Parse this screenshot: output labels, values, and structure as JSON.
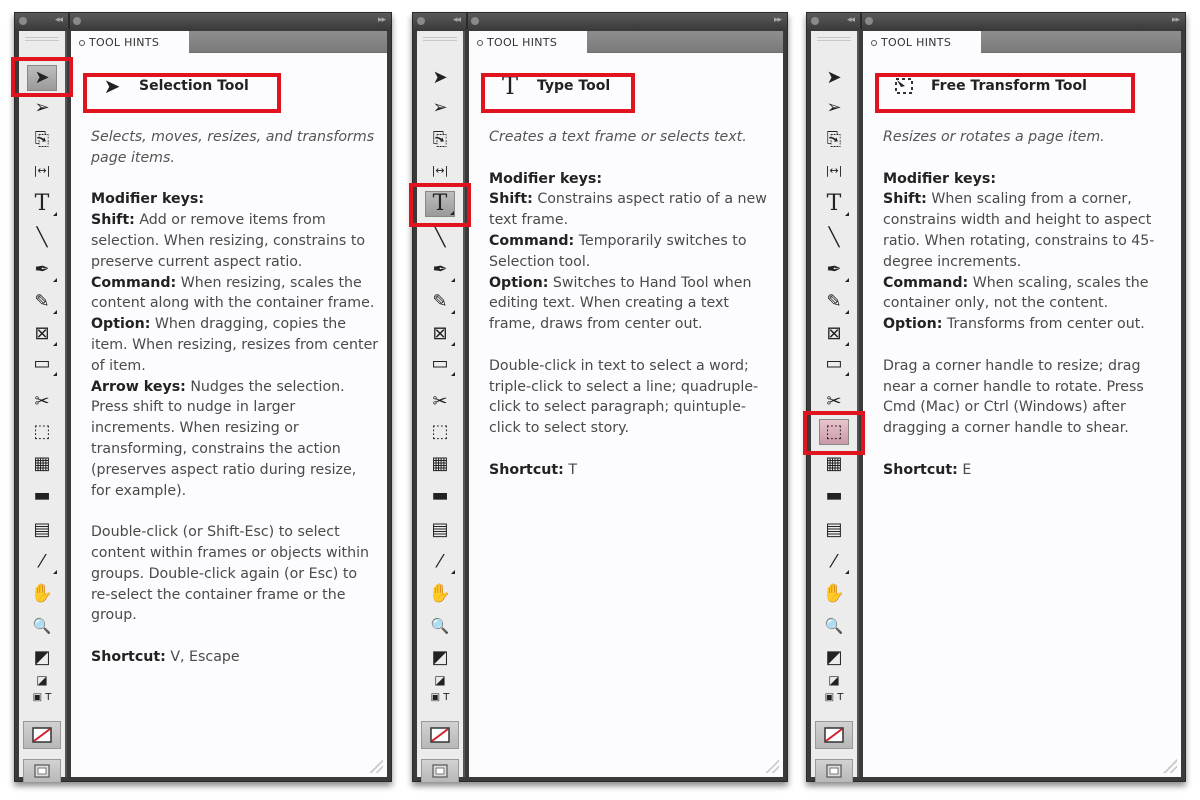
{
  "panels": [
    {
      "tab_label": "TOOL HINTS",
      "hint": {
        "icon": "selection-arrow-icon",
        "title": "Selection Tool",
        "description": "Selects, moves, resizes, and transforms page items.",
        "modifier_heading": "Modifier keys:",
        "modifiers": [
          {
            "key": "Shift:",
            "text": " Add or remove items from selection. When resizing, constrains to preserve current aspect ratio."
          },
          {
            "key": "Command:",
            "text": " When resizing, scales the content along with the container frame."
          },
          {
            "key": "Option:",
            "text": " When dragging, copies the item. When resizing, resizes from center of item."
          },
          {
            "key": "Arrow keys:",
            "text": " Nudges the selection. Press shift to nudge in larger increments. When resizing or transforming, constrains the action (preserves aspect ratio during resize, for example)."
          }
        ],
        "extra": "Double-click (or Shift-Esc) to select content within frames or objects within groups. Double-click again (or Esc) to re-select the container frame or the group.",
        "shortcut_label": "Shortcut:",
        "shortcut_value": " V, Escape"
      },
      "active_tool": "selection"
    },
    {
      "tab_label": "TOOL HINTS",
      "hint": {
        "icon": "type-tool-icon",
        "title": "Type Tool",
        "description": "Creates a text frame or selects text.",
        "modifier_heading": "Modifier keys:",
        "modifiers": [
          {
            "key": "Shift:",
            "text": " Constrains aspect ratio of a new text frame."
          },
          {
            "key": "Command:",
            "text": " Temporarily switches to Selection tool."
          },
          {
            "key": "Option:",
            "text": " Switches to Hand Tool when editing text. When creating a text frame, draws from center out."
          }
        ],
        "extra": "Double-click in text to select a word; triple-click to select a line; quadruple-click to select paragraph; quintuple-click to select story.",
        "shortcut_label": "Shortcut:",
        "shortcut_value": " T"
      },
      "active_tool": "type"
    },
    {
      "tab_label": "TOOL HINTS",
      "hint": {
        "icon": "free-transform-icon",
        "title": "Free Transform Tool",
        "description": "Resizes or rotates a page item.",
        "modifier_heading": "Modifier keys:",
        "modifiers": [
          {
            "key": "Shift:",
            "text": " When scaling from a corner, constrains width and height to aspect ratio. When rotating, constrains to 45-degree increments."
          },
          {
            "key": "Command:",
            "text": " When scaling, scales the container only, not the content."
          },
          {
            "key": "Option:",
            "text": " Transforms from center out."
          }
        ],
        "extra": "Drag a corner handle to resize; drag near a corner handle to rotate. Press Cmd (Mac) or Ctrl (Windows) after dragging a corner handle to shear.",
        "shortcut_label": "Shortcut:",
        "shortcut_value": " E"
      },
      "active_tool": "free-transform"
    }
  ],
  "toolbox": {
    "tools": [
      {
        "id": "selection",
        "icon": "selection-arrow-icon",
        "glyph": "➤"
      },
      {
        "id": "direct-selection",
        "icon": "direct-selection-icon",
        "glyph": "➢"
      },
      {
        "id": "page",
        "icon": "page-tool-icon",
        "glyph": "⎘"
      },
      {
        "id": "gap",
        "icon": "gap-tool-icon",
        "glyph": "|↔|"
      },
      {
        "id": "type",
        "icon": "type-tool-icon",
        "glyph": "T"
      },
      {
        "id": "line",
        "icon": "line-tool-icon",
        "glyph": "╲"
      },
      {
        "id": "pen",
        "icon": "pen-tool-icon",
        "glyph": "✒"
      },
      {
        "id": "pencil",
        "icon": "pencil-tool-icon",
        "glyph": "✎"
      },
      {
        "id": "rect-frame",
        "icon": "rectangle-frame-icon",
        "glyph": "⊠"
      },
      {
        "id": "rectangle",
        "icon": "rectangle-tool-icon",
        "glyph": "▭"
      },
      {
        "id": "scissors",
        "icon": "scissors-icon",
        "glyph": "✂"
      },
      {
        "id": "free-transform",
        "icon": "free-transform-icon",
        "glyph": "⬚"
      },
      {
        "id": "gradient",
        "icon": "gradient-swatch-icon",
        "glyph": "▦"
      },
      {
        "id": "gradient-feather",
        "icon": "gradient-feather-icon",
        "glyph": "▬"
      },
      {
        "id": "note",
        "icon": "note-tool-icon",
        "glyph": "▤"
      },
      {
        "id": "eyedropper",
        "icon": "eyedropper-icon",
        "glyph": "⁄"
      },
      {
        "id": "hand",
        "icon": "hand-tool-icon",
        "glyph": "✋"
      },
      {
        "id": "zoom",
        "icon": "zoom-tool-icon",
        "glyph": "🔍"
      },
      {
        "id": "fill-stroke",
        "icon": "fill-stroke-icon",
        "glyph": "◩"
      },
      {
        "id": "default-colors",
        "icon": "default-colors-icon",
        "glyph": "◪"
      },
      {
        "id": "container-text",
        "icon": "formatting-container-icon",
        "glyph": "▣ T"
      }
    ],
    "apply_none_icon": "apply-none-icon",
    "view_mode_icon": "screen-mode-icon"
  }
}
